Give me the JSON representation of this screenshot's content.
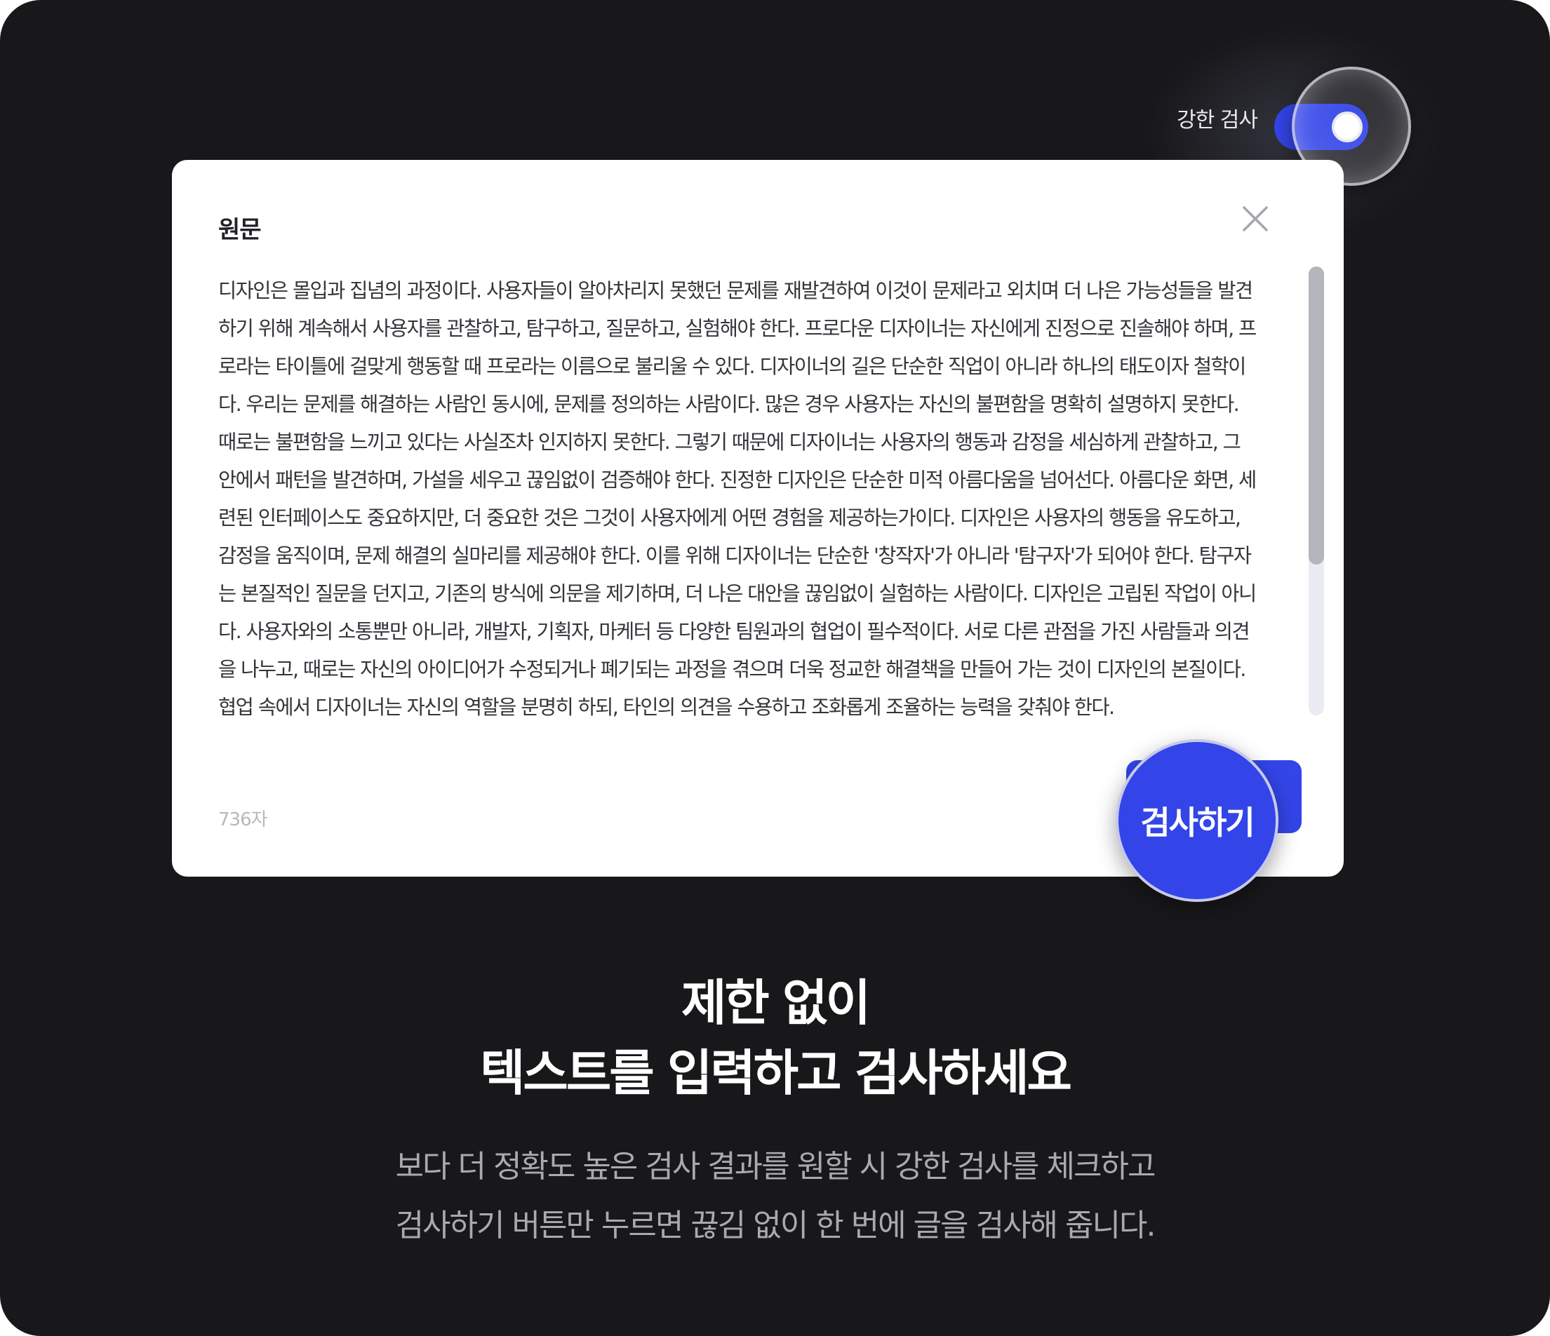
{
  "toggle": {
    "label": "강한 검사",
    "on": true,
    "accent": "#3345e8"
  },
  "editor": {
    "title": "원문",
    "text": "디자인은 몰입과 집념의 과정이다. 사용자들이 알아차리지 못했던 문제를 재발견하여 이것이 문제라고 외치며 더 나은 가능성들을 발견하기 위해 계속해서 사용자를 관찰하고, 탐구하고, 질문하고, 실험해야 한다. 프로다운 디자이너는 자신에게 진정으로 진솔해야 하며, 프로라는 타이틀에 걸맞게 행동할 때 프로라는 이름으로 불리울 수 있다. 디자이너의 길은 단순한 직업이 아니라 하나의 태도이자 철학이다. 우리는 문제를 해결하는 사람인 동시에, 문제를 정의하는 사람이다. 많은 경우 사용자는 자신의 불편함을 명확히 설명하지 못한다. 때로는 불편함을 느끼고 있다는 사실조차 인지하지 못한다. 그렇기 때문에 디자이너는 사용자의 행동과 감정을 세심하게 관찰하고, 그 안에서 패턴을 발견하며, 가설을 세우고 끊임없이 검증해야 한다. 진정한 디자인은 단순한 미적 아름다움을 넘어선다. 아름다운 화면, 세련된 인터페이스도 중요하지만, 더 중요한 것은 그것이 사용자에게 어떤 경험을 제공하는가이다. 디자인은 사용자의 행동을 유도하고, 감정을 움직이며, 문제 해결의 실마리를 제공해야 한다. 이를 위해 디자이너는 단순한 '창작자'가 아니라 '탐구자'가 되어야 한다. 탐구자는 본질적인 질문을 던지고, 기존의 방식에 의문을 제기하며, 더 나은 대안을 끊임없이 실험하는 사람이다. 디자인은 고립된 작업이 아니다. 사용자와의 소통뿐만 아니라, 개발자, 기획자, 마케터 등 다양한 팀원과의 협업이 필수적이다. 서로 다른 관점을 가진 사람들과 의견을 나누고, 때로는 자신의 아이디어가 수정되거나 폐기되는 과정을 겪으며 더욱 정교한 해결책을 만들어 가는 것이 디자인의 본질이다. 협업 속에서 디자이너는 자신의 역할을 분명히 하되, 타인의 의견을 수용하고 조화롭게 조율하는 능력을 갖춰야 한다.",
    "char_count": "736자",
    "check_button_label": "검사하기",
    "close_icon": "close-icon"
  },
  "headline": {
    "line1": "제한 없이",
    "line2": "텍스트를 입력하고 검사하세요"
  },
  "description": {
    "line1": "보다 더 정확도 높은 검사 결과를 원할 시 강한 검사를 체크하고",
    "line2": "검사하기 버튼만 누르면 끊김 없이 한 번에 글을 검사해 줍니다."
  },
  "colors": {
    "background": "#18181b",
    "card": "#ffffff",
    "accent": "#3345e8"
  }
}
